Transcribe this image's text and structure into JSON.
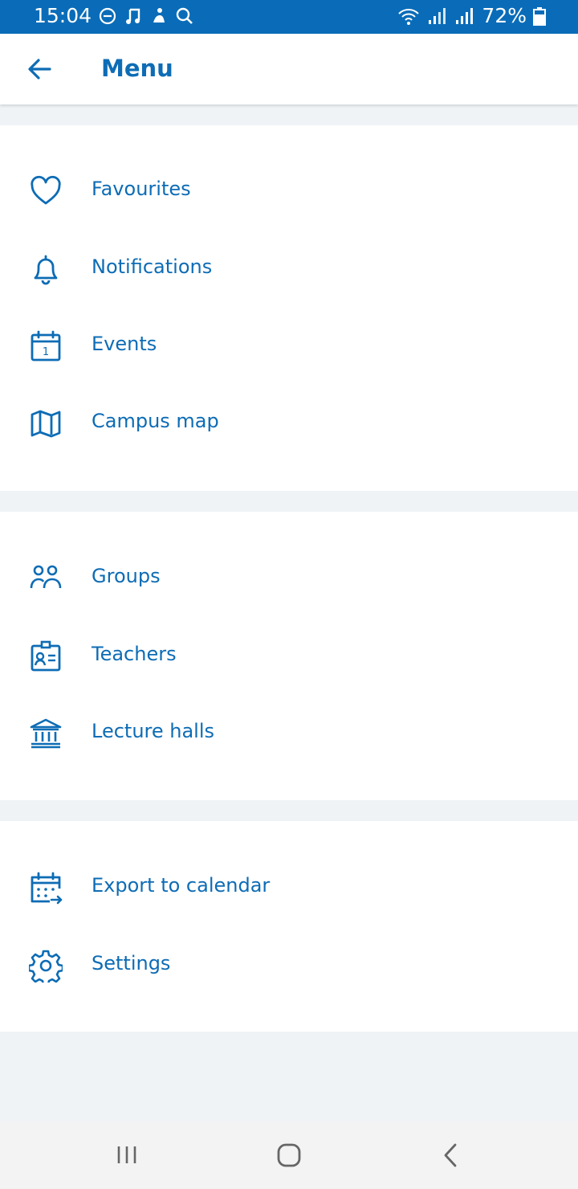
{
  "status_bar": {
    "time": "15:04",
    "battery": "72%"
  },
  "header": {
    "title": "Menu",
    "back_icon": "arrow-left-icon"
  },
  "sections": [
    {
      "items": [
        {
          "label": "Favourites",
          "icon": "heart-icon"
        },
        {
          "label": "Notifications",
          "icon": "bell-icon"
        },
        {
          "label": "Events",
          "icon": "calendar-icon"
        },
        {
          "label": "Campus map",
          "icon": "map-icon"
        }
      ]
    },
    {
      "items": [
        {
          "label": "Groups",
          "icon": "users-icon"
        },
        {
          "label": "Teachers",
          "icon": "id-badge-icon"
        },
        {
          "label": "Lecture halls",
          "icon": "building-icon"
        }
      ]
    },
    {
      "items": [
        {
          "label": "Export to calendar",
          "icon": "calendar-export-icon"
        },
        {
          "label": "Settings",
          "icon": "gear-icon"
        }
      ]
    }
  ],
  "colors": {
    "accent": "#0d6cb5",
    "status_bar": "#0a6cb8",
    "background": "#f0f3f6"
  }
}
